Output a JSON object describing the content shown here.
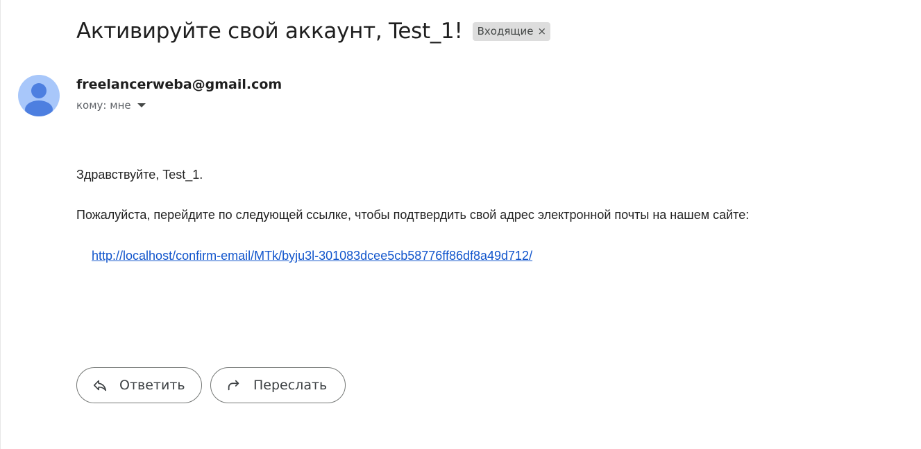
{
  "email": {
    "subject": "Активируйте свой аккаунт, Test_1!",
    "label": "Входящие",
    "label_remove_glyph": "×",
    "sender": "freelancerweba@gmail.com",
    "recipient": "кому: мне",
    "body": {
      "greeting": "Здравствуйте, Test_1.",
      "instruction": "Пожалуйста, перейдите по следующей ссылке, чтобы подтвердить свой адрес электронной почты на нашем сайте:",
      "link": "http://localhost/confirm-email/MTk/byju3l-301083dcee5cb58776ff86df8a49d712/"
    }
  },
  "actions": {
    "reply_label": "Ответить",
    "forward_label": "Переслать"
  },
  "icons": {
    "avatar": "person-avatar-icon",
    "recipient_dropdown": "chevron-down-icon",
    "reply": "reply-icon",
    "forward": "forward-icon"
  },
  "colors": {
    "avatar_bg": "#a8c7fa",
    "avatar_figure": "#4d7fe0",
    "link": "#1155cc",
    "label_chip_bg": "#dddddd"
  }
}
